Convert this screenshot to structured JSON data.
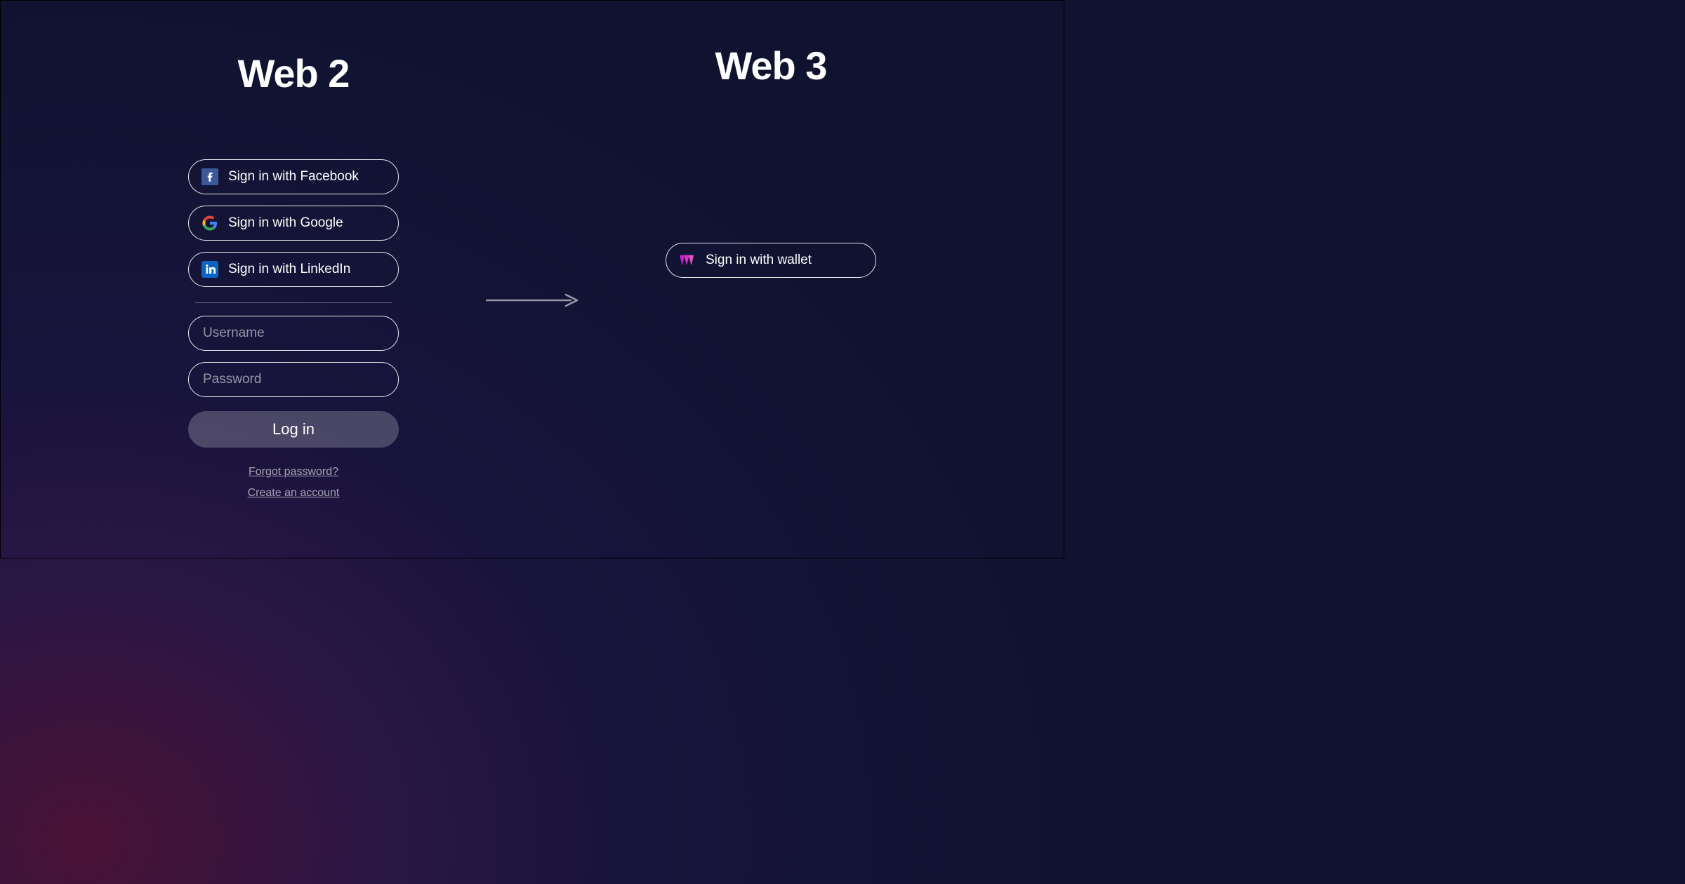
{
  "web2": {
    "title": "Web 2",
    "signin_facebook": "Sign in with Facebook",
    "signin_google": "Sign in with Google",
    "signin_linkedin": "Sign in with LinkedIn",
    "username_placeholder": "Username",
    "password_placeholder": "Password",
    "login_label": "Log in",
    "forgot_label": "Forgot password?",
    "create_label": "Create an account"
  },
  "web3": {
    "title": "Web 3",
    "signin_wallet": "Sign in with wallet"
  }
}
